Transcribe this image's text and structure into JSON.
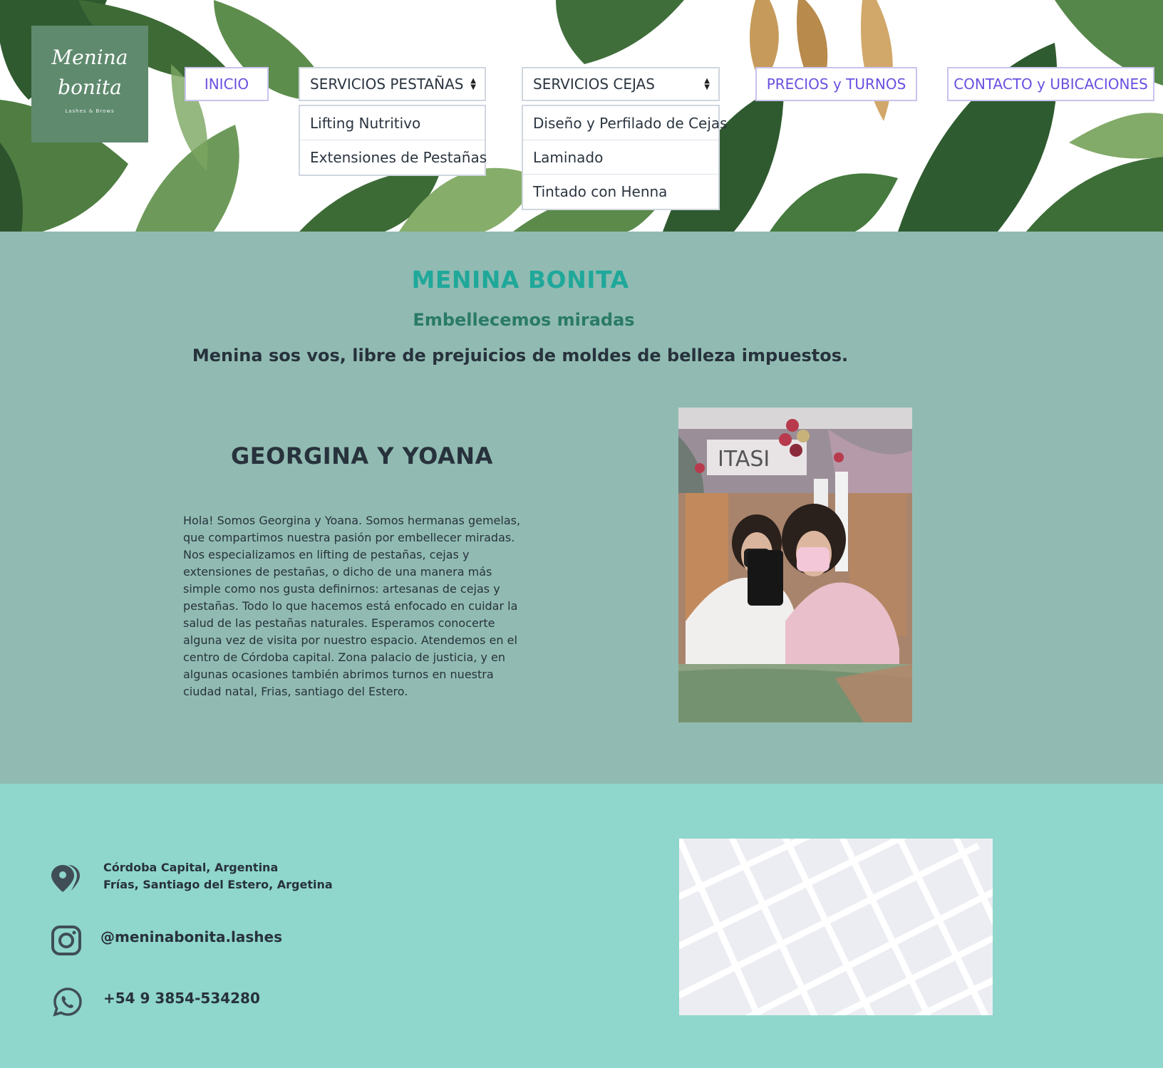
{
  "logo": {
    "line1": "Menina",
    "line2": "bonita",
    "line3": "Lashes & Brows"
  },
  "nav": {
    "inicio": "INICIO",
    "pestanas": {
      "selected": "SERVICIOS PESTAÑAS",
      "options": [
        "Lifting Nutritivo",
        "Extensiones de Pestañas"
      ]
    },
    "cejas": {
      "selected": "SERVICIOS CEJAS",
      "options": [
        "Diseño y Perfilado de Cejas",
        "Laminado",
        "Tintado con Henna"
      ]
    },
    "precios": "PRECIOS y TURNOS",
    "contacto": "CONTACTO y UBICACIONES"
  },
  "about": {
    "title": "MENINA BONITA",
    "subtitle": "Embellecemos miradas",
    "tagline": "Menina sos vos, libre de prejuicios de moldes de belleza impuestos.",
    "names": "GEORGINA Y YOANA",
    "bio": "Hola! Somos Georgina y Yoana. Somos hermanas gemelas, que compartimos nuestra pasión por embellecer miradas. Nos especializamos en lifting de pestañas, cejas y extensiones de pestañas, o dicho de una manera más simple como nos gusta definirnos: artesanas de cejas y pestañas. Todo lo que hacemos está enfocado en cuidar la salud de las pestañas naturales. Esperamos conocerte alguna vez de visita por nuestro espacio. Atendemos en el centro de Córdoba capital. Zona palacio de justicia, y en algunas ocasiones también abrimos turnos en nuestra ciudad natal, Frias, santiago del Estero."
  },
  "contact": {
    "address1": "Córdoba Capital, Argentina",
    "address2": "Frías, Santiago del Estero, Argetina",
    "instagram": "@meninabonita.lashes",
    "phone": "+54 9 3854-534280"
  },
  "colors": {
    "accent": "#6b4fe0",
    "title": "#1fa89a",
    "about_bg": "#91bbb2",
    "footer_bg": "#8fd6cc",
    "text": "#27323c"
  },
  "icons": [
    "map-pin-icon",
    "instagram-icon",
    "whatsapp-icon",
    "select-caret-icon"
  ]
}
